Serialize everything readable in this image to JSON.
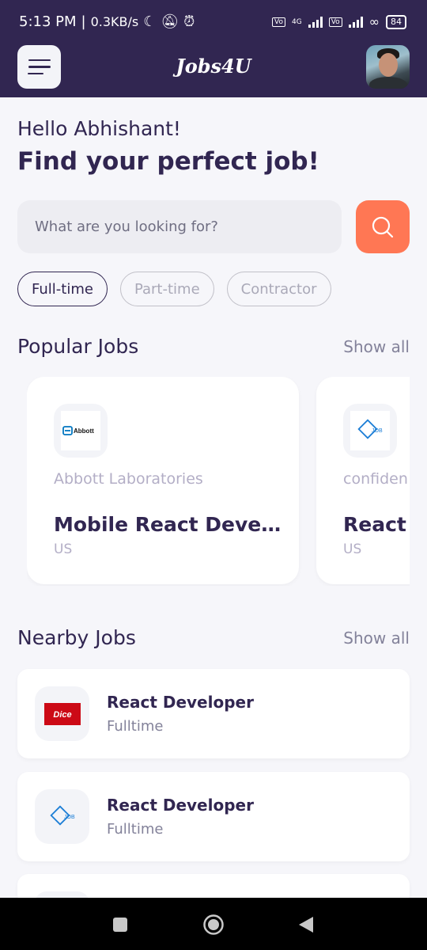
{
  "status_bar": {
    "time": "5:13 PM",
    "network_speed": "0.3KB/s",
    "network_type": "4G",
    "battery": "84"
  },
  "header": {
    "app_title": "Jobs4U"
  },
  "welcome": {
    "greeting": "Hello Abhishant!",
    "headline": "Find your perfect job!"
  },
  "search": {
    "placeholder": "What are you looking for?"
  },
  "job_types": [
    {
      "label": "Full-time",
      "active": true
    },
    {
      "label": "Part-time",
      "active": false
    },
    {
      "label": "Contractor",
      "active": false
    }
  ],
  "popular": {
    "title": "Popular Jobs",
    "show_all": "Show all",
    "jobs": [
      {
        "logo_text": "Abbott",
        "company": "Abbott Laboratories",
        "title": "Mobile React Develo...",
        "location": "US"
      },
      {
        "logo_text": "JOB",
        "company": "confiden",
        "title": "React D",
        "location": "US"
      }
    ]
  },
  "nearby": {
    "title": "Nearby Jobs",
    "show_all": "Show all",
    "jobs": [
      {
        "logo_text": "Dice",
        "title": "React Developer",
        "type": "Fulltime"
      },
      {
        "logo_text": "JOB",
        "title": "React Developer",
        "type": "Fulltime"
      }
    ]
  },
  "colors": {
    "primary": "#312651",
    "accent": "#FF7754",
    "gray": "#83829A",
    "background": "#F6F6FA"
  }
}
